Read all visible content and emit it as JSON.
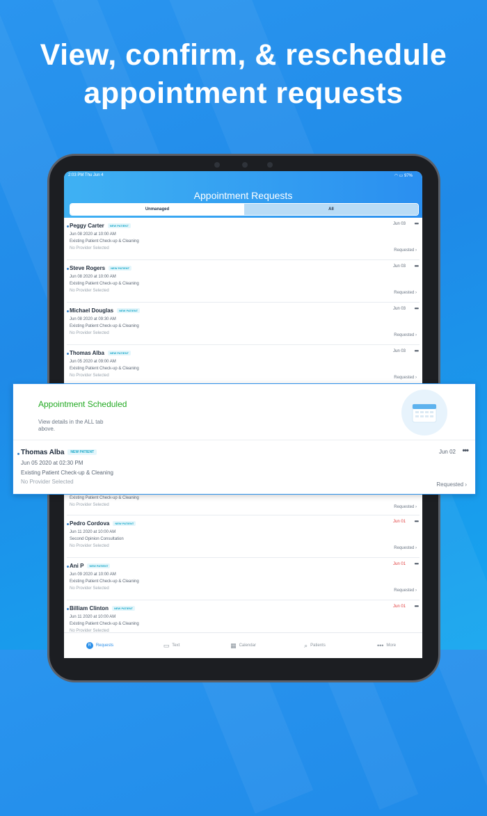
{
  "headline": {
    "line1": "View, confirm, & reschedule",
    "line2": "appointment requests"
  },
  "status_bar": {
    "time_date": "2:03 PM   Thu Jun 4",
    "battery": "97%"
  },
  "app": {
    "title": "Appointment Requests",
    "segments": [
      {
        "label": "Unmanaged",
        "active": true
      },
      {
        "label": "All",
        "active": false
      }
    ]
  },
  "requests": [
    {
      "name": "Peggy Carter",
      "badge": "NEW PATIENT",
      "datetime": "Jun 08 2020 at 10:00 AM",
      "reason": "Existing Patient Check-up & Cleaning",
      "provider": "No Provider Selected",
      "date": "Jun 03",
      "status": "Requested"
    },
    {
      "name": "Steve Rogers",
      "badge": "NEW PATIENT",
      "datetime": "Jun 08 2020 at 10:00 AM",
      "reason": "Existing Patient Check-up & Cleaning",
      "provider": "No Provider Selected",
      "date": "Jun 03",
      "status": "Requested"
    },
    {
      "name": "Michael Douglas",
      "badge": "NEW PATIENT",
      "datetime": "Jun 08 2020 at 09:30 AM",
      "reason": "Existing Patient Check-up & Cleaning",
      "provider": "No Provider Selected",
      "date": "Jun 03",
      "status": "Requested"
    },
    {
      "name": "Thomas Alba",
      "badge": "NEW PATIENT",
      "datetime": "Jun 05 2020 at 09:00 AM",
      "reason": "Existing Patient Check-up & Cleaning",
      "provider": "No Provider Selected",
      "date": "Jun 03",
      "status": "Requested"
    }
  ],
  "partial_row": {
    "reason": "Existing Patient Check-up & Cleaning",
    "provider": "No Provider Selected",
    "status": "Requested"
  },
  "requests_lower": [
    {
      "name": "Pedro Cordova",
      "badge": "NEW PATIENT",
      "datetime": "Jun 11 2020 at 10:00 AM",
      "reason": "Second Opinion Consultation",
      "provider": "No Provider Selected",
      "date": "Jun 01",
      "status": "Requested"
    },
    {
      "name": "Ani P",
      "badge": "NEW PATIENT",
      "datetime": "Jun 09 2020 at 10:00 AM",
      "reason": "Existing Patient Check-up & Cleaning",
      "provider": "No Provider Selected",
      "date": "Jun 01",
      "status": "Requested"
    },
    {
      "name": "Billiam Clinton",
      "badge": "NEW PATIENT",
      "datetime": "Jun 11 2020 at 10:00 AM",
      "reason": "Existing Patient Check-up & Cleaning",
      "provider": "No Provider Selected",
      "date": "Jun 01",
      "status": ""
    }
  ],
  "card": {
    "title": "Appointment Scheduled",
    "message": "View details in the ALL tab above.",
    "name": "Thomas Alba",
    "badge": "NEW PATIENT",
    "datetime": "Jun 05 2020 at 02:30 PM",
    "reason": "Existing Patient Check-up & Cleaning",
    "provider": "No Provider Selected",
    "date": "Jun 02",
    "status": "Requested"
  },
  "tabs": [
    {
      "label": "Requests",
      "icon": "requests-icon",
      "active": true
    },
    {
      "label": "Text",
      "icon": "chat-icon",
      "active": false
    },
    {
      "label": "Calendar",
      "icon": "calendar-icon",
      "active": false
    },
    {
      "label": "Patients",
      "icon": "search-icon",
      "active": false
    },
    {
      "label": "More",
      "icon": "more-dots-icon",
      "active": false
    }
  ],
  "colors": {
    "accent": "#2a8fe9",
    "success": "#21a921",
    "overdue": "#e03a3a",
    "badge": "#18a8c9"
  }
}
